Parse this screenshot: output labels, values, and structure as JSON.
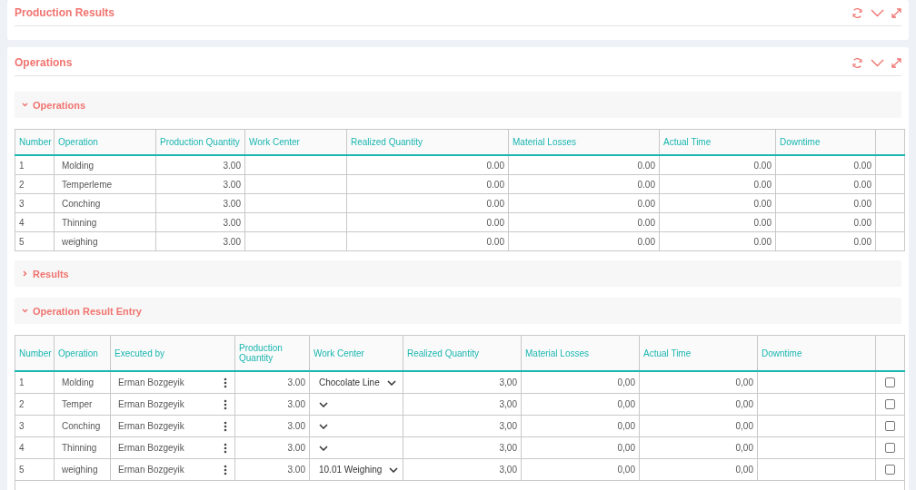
{
  "panels": [
    {
      "title": "Production Results"
    },
    {
      "title": "Operations",
      "sections": [
        {
          "title": "Operations",
          "expanded": true,
          "kind": "summary",
          "columns": [
            "Number",
            "Operation",
            "Production Quantity",
            "Work Center",
            "Realized Quantity",
            "Material Losses",
            "Actual Time",
            "Downtime"
          ],
          "rows": [
            {
              "number": "1",
              "operation": "Molding",
              "production_quantity": "3.00",
              "realized_quantity": "0.00",
              "material_losses": "0.00",
              "actual_time": "0.00",
              "downtime": "0.00"
            },
            {
              "number": "2",
              "operation": "Temperleme",
              "production_quantity": "3.00",
              "realized_quantity": "0.00",
              "material_losses": "0.00",
              "actual_time": "0.00",
              "downtime": "0.00"
            },
            {
              "number": "3",
              "operation": "Conching",
              "production_quantity": "3.00",
              "realized_quantity": "0.00",
              "material_losses": "0.00",
              "actual_time": "0.00",
              "downtime": "0.00"
            },
            {
              "number": "4",
              "operation": "Thinning",
              "production_quantity": "3.00",
              "realized_quantity": "0.00",
              "material_losses": "0.00",
              "actual_time": "0.00",
              "downtime": "0.00"
            },
            {
              "number": "5",
              "operation": "weighing",
              "production_quantity": "3.00",
              "realized_quantity": "0.00",
              "material_losses": "0.00",
              "actual_time": "0.00",
              "downtime": "0.00"
            }
          ]
        },
        {
          "title": "Results",
          "expanded": false
        },
        {
          "title": "Operation Result Entry",
          "expanded": true,
          "kind": "entry",
          "columns": [
            "Number",
            "Operation",
            "Executed by",
            "Production Quantity",
            "Work Center",
            "Realized Quantity",
            "Material Losses",
            "Actual Time",
            "Downtime"
          ],
          "rows": [
            {
              "number": "1",
              "operation": "Molding",
              "executed_by": "Erman Bozgeyik",
              "production_quantity": "3.00",
              "work_center": "Chocolate Line",
              "realized_quantity": "3,00",
              "material_losses": "0,00",
              "actual_time": "0,00",
              "checked": false
            },
            {
              "number": "2",
              "operation": "Temper",
              "executed_by": "Erman Bozgeyik",
              "production_quantity": "3.00",
              "realized_quantity": "3,00",
              "material_losses": "0,00",
              "actual_time": "0,00",
              "checked": false
            },
            {
              "number": "3",
              "operation": "Conching",
              "executed_by": "Erman Bozgeyik",
              "production_quantity": "3.00",
              "realized_quantity": "3,00",
              "material_losses": "0,00",
              "actual_time": "0,00",
              "checked": false
            },
            {
              "number": "4",
              "operation": "Thinning",
              "executed_by": "Erman Bozgeyik",
              "production_quantity": "3.00",
              "realized_quantity": "3,00",
              "material_losses": "0,00",
              "actual_time": "0,00",
              "checked": false
            },
            {
              "number": "5",
              "operation": "weighing",
              "executed_by": "Erman Bozgeyik",
              "production_quantity": "3.00",
              "work_center": "10.01 Weighing",
              "realized_quantity": "3,00",
              "material_losses": "0,00",
              "actual_time": "0,00",
              "checked": false
            }
          ]
        }
      ]
    }
  ]
}
